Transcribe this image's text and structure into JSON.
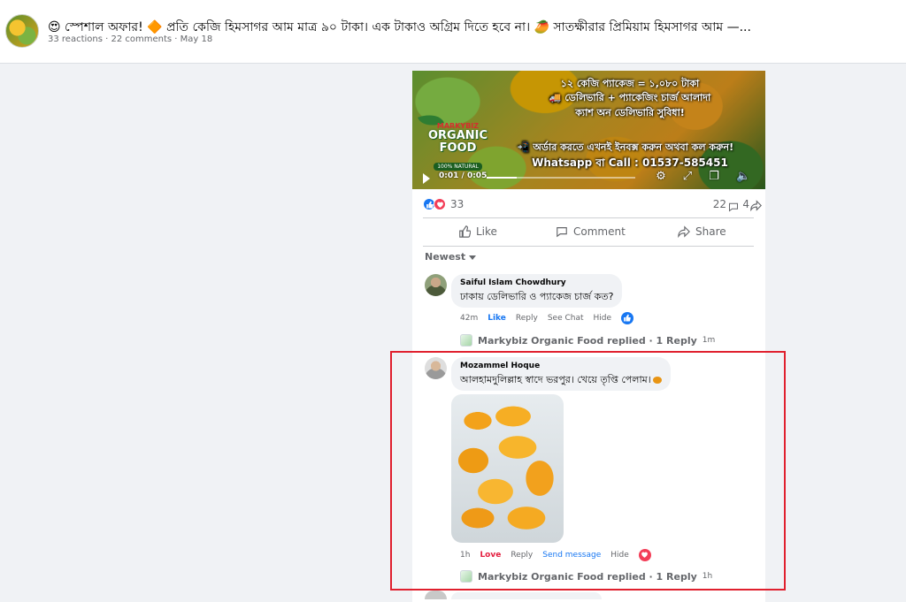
{
  "header": {
    "title": "😍 স্পেশাল অফার! 🔶 প্রতি কেজি হিমসাগর আম মাত্র ৯০ টাকা। এক টাকাও অগ্রিম দিতে হবে না। 🥭 সাতক্ষীরার প্রিমিয়াম হিমসাগর আম —...",
    "meta": "33 reactions · 22 comments · May 18"
  },
  "video": {
    "line1": "১২ কেজি প্যাকেজ = ১,০৮০ টাকা",
    "line2": "🚚 ডেলিভারি + প্যাকেজিং চার্জ আলাদা",
    "line3": "ক্যাশ অন ডেলিভারি সুবিধা!",
    "line4": "📲 অর্ডার করতে এখনই ইনবক্স করুন অথবা কল করুন!",
    "line5": "Whatsapp বা  Call : 01537-585451",
    "brand_top": "MARKYBIZ",
    "brand_l1": "ORGANIC",
    "brand_l2": "FOOD",
    "brand_tag": "100% NATURAL",
    "time": "0:01 / 0:05",
    "progress": 0.2
  },
  "stats": {
    "reactions": "33",
    "comments": "22",
    "shares": "4"
  },
  "actions": {
    "like": "Like",
    "comment": "Comment",
    "share": "Share"
  },
  "sort": {
    "label": "Newest"
  },
  "comments": [
    {
      "author": "Saiful Islam Chowdhury",
      "text": "ঢাকায় ডেলিভারি ও প্যাকেজ চার্জ কত?",
      "time": "42m",
      "reaction_action": "Like",
      "reply": "Reply",
      "see_chat": "See Chat",
      "hide": "Hide",
      "replied_by": "Markybiz Organic Food replied · 1 Reply",
      "replied_time": "1m"
    },
    {
      "author": "Mozammel Hoque",
      "text": "আলহামদুলিল্লাহ স্বাদে ভরপুর। খেয়ে তৃপ্তি পেলাম।",
      "time": "1h",
      "reaction_action": "Love",
      "reply": "Reply",
      "send_message": "Send message",
      "hide": "Hide",
      "replied_by": "Markybiz Organic Food replied · 1 Reply",
      "replied_time": "1h"
    }
  ],
  "colors": {
    "accent": "#1877f2",
    "love": "#f33e58",
    "highlight_box": "#e0202e"
  }
}
